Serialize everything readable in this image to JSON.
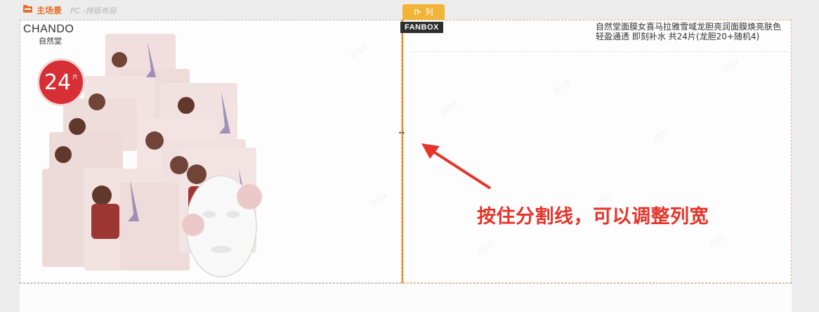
{
  "header": {
    "scene_icon": "folder-icon",
    "scene_label": "主场景",
    "scene_sub": "PC -排版布局"
  },
  "column_tag": {
    "icon": "column-icon",
    "label": "列"
  },
  "left_column": {
    "brand_en": "CHANDO",
    "brand_cn": "自然堂",
    "count_value": "24",
    "count_unit": "片"
  },
  "right_column": {
    "badge": "FANBOX",
    "product_title": "自然堂面膜女喜马拉雅雪域龙胆亮润面膜焕亮肤色 轻盈通透 即刻补水 共24片(龙胆20+随机4)"
  },
  "annotation": {
    "hint": "按住分割线，可以调整列宽",
    "handle_icon": "resize-horizontal-icon",
    "arrow_icon": "arrow-pointer-icon",
    "color": "#e7342a"
  },
  "colors": {
    "accent": "#e58a37",
    "tag": "#f1b437",
    "badge": "#d72f35"
  }
}
